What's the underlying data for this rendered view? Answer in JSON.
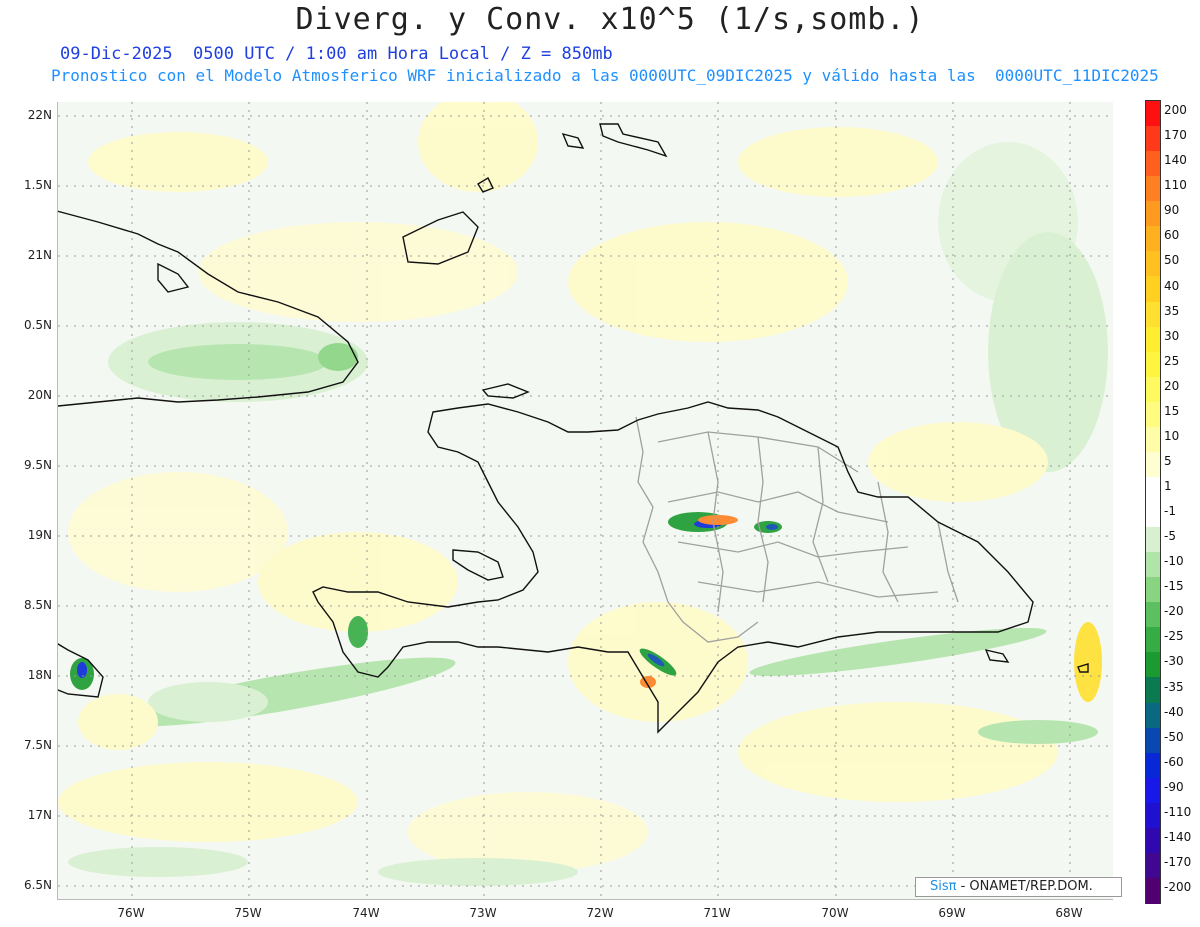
{
  "header": {
    "title": "Diverg. y Conv. x10^5 (1/s,somb.)",
    "subtitle": "09-Dic-2025  0500 UTC / 1:00 am Hora Local / Z = 850mb",
    "info": "Pronostico con el Modelo Atmosferico WRF inicializado a las 0000UTC_09DIC2025 y válido hasta las  0000UTC_11DIC2025"
  },
  "axes": {
    "lat_labels": [
      "22N",
      "1.5N",
      "21N",
      "0.5N",
      "20N",
      "9.5N",
      "19N",
      "8.5N",
      "18N",
      "7.5N",
      "17N",
      "6.5N"
    ],
    "lon_labels": [
      "76W",
      "75W",
      "74W",
      "73W",
      "72W",
      "71W",
      "70W",
      "69W",
      "68W"
    ]
  },
  "colorbar": {
    "labels": [
      "200",
      "170",
      "140",
      "110",
      "90",
      "60",
      "50",
      "40",
      "35",
      "30",
      "25",
      "20",
      "15",
      "10",
      "5",
      "1",
      "-1",
      "-5",
      "-10",
      "-15",
      "-20",
      "-25",
      "-30",
      "-35",
      "-40",
      "-50",
      "-60",
      "-90",
      "-110",
      "-140",
      "-170",
      "-200"
    ],
    "colors": [
      "#ff1010",
      "#ff3a1a",
      "#ff6020",
      "#ff8020",
      "#ff9a20",
      "#ffb020",
      "#ffc020",
      "#ffd020",
      "#ffe030",
      "#ffee30",
      "#fff540",
      "#fffa60",
      "#fffc80",
      "#fffda8",
      "#fffed0",
      "#ffffff",
      "#ffffff",
      "#d8f0d0",
      "#b0e4a8",
      "#88d480",
      "#5cc060",
      "#36ac44",
      "#1a9a30",
      "#0c7a50",
      "#0a6880",
      "#0848b0",
      "#0828d8",
      "#1818e8",
      "#2010d0",
      "#3008b0",
      "#400890",
      "#500070"
    ]
  },
  "credit": {
    "brand": "Sisπ",
    "text": "- ONAMET/REP.DOM."
  }
}
